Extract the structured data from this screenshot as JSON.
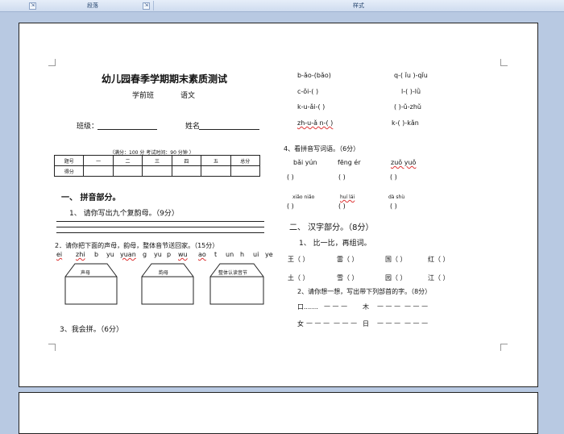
{
  "ribbon": {
    "section_left": "段落",
    "section_right": "样式",
    "launcher": "⇲"
  },
  "left": {
    "title": "幼儿园春季学期期末素质测试",
    "class_label": "学前班",
    "subject": "语文",
    "class_field": "班级：",
    "name_field": "姓名",
    "score_info": "（满分：100 分       考试时间：90 分钟  ）",
    "table": {
      "row1": [
        "题号",
        "一",
        "二",
        "三",
        "四",
        "五",
        "总分"
      ],
      "row2": [
        "得分",
        "",
        "",
        "",
        "",
        "",
        ""
      ]
    },
    "section1": "一、 拼音部分。",
    "q1": "1、  请你写出九个复韵母。（9分）",
    "q2": "2．请你把下面的声母，韵母，整体音节送回家。（15分）",
    "pinyin_list": [
      "ei",
      "zhi",
      "b",
      "yu",
      "yuan",
      "g",
      "yu",
      "p",
      "wu",
      "ao",
      "t",
      "un",
      "h",
      "ui",
      "ye"
    ],
    "houses": [
      "声母",
      "韵母",
      "整体认读音节"
    ],
    "q3": "3、我会拼。（6分）"
  },
  "right": {
    "spell_rows": [
      [
        "b-ǎo-(bǎo)",
        "q-(  ǐu  )-qǐu"
      ],
      [
        "c-ǒi-(          )",
        "l-(      )-lǜ"
      ],
      [
        "k-u-ǎi-(          )",
        "(          )-ǔ-zhǔ"
      ],
      [
        "zh-u-ǎ n-(    )",
        "k-(        )-kǎn"
      ]
    ],
    "q4": "4、看拼音写词语。（6分）",
    "words1": [
      "bǎi  yún",
      "fēng  ér",
      "zuǒ  yuǒ"
    ],
    "paren": "(              )",
    "words2": [
      "xiǎo  niǎo",
      "huí  lái",
      "dà  shù"
    ],
    "section2": "二、 汉字部分。（8分）",
    "q5": "1、   比一比，再组词。",
    "compare": [
      [
        "王（          ）",
        "雷（          ）",
        "国（          ）",
        "红（          ）"
      ],
      [
        "土（          ）",
        "雪（          ）",
        "园（          ）",
        "江（          ）"
      ]
    ],
    "q6": "2、请你想一想，写出带下列部首的字。（8分）",
    "radicals": [
      [
        "口.......",
        "— — —",
        "木",
        "— — —",
        "— — —"
      ],
      [
        "女",
        "— — —",
        "— — —",
        "日",
        "— — —",
        "— — —"
      ]
    ]
  }
}
